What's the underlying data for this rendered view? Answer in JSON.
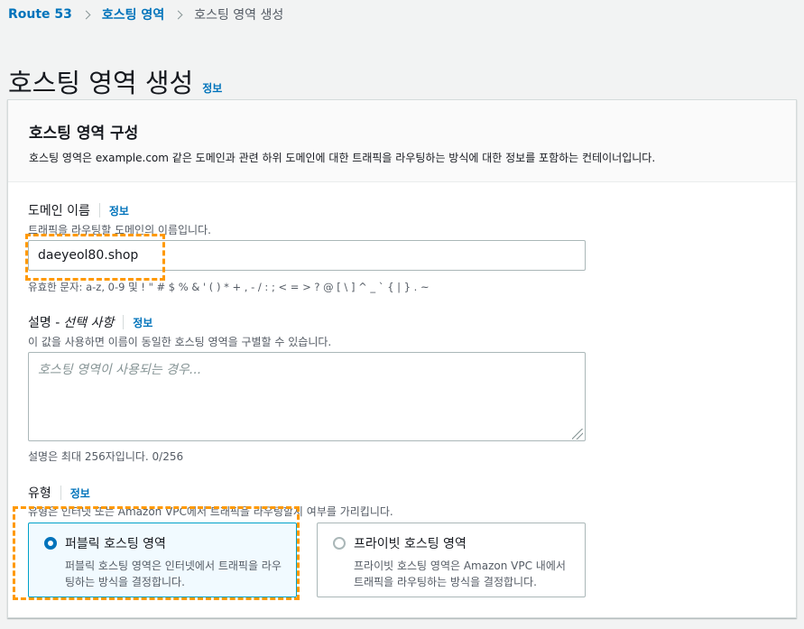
{
  "breadcrumb": {
    "root": "Route 53",
    "parent": "호스팅 영역",
    "current": "호스팅 영역 생성"
  },
  "page": {
    "title": "호스팅 영역 생성",
    "info": "정보"
  },
  "panel": {
    "title": "호스팅 영역 구성",
    "description": "호스팅 영역은 example.com 같은 도메인과 관련 하위 도메인에 대한 트래픽을 라우팅하는 방식에 대한 정보를 포함하는 컨테이너입니다."
  },
  "domain": {
    "label": "도메인 이름",
    "info": "정보",
    "description": "트래픽을 라우팅할 도메인의 이름입니다.",
    "value": "daeyeol80.shop",
    "constraint": "유효한 문자: a-z, 0-9 및 ! \" # $ % & ' ( ) * + , - / : ; < = > ? @ [ \\ ] ^ _ ` { | } . ~"
  },
  "description_field": {
    "label_main": "설명 - ",
    "label_optional": "선택 사항",
    "info": "정보",
    "description": "이 값을 사용하면 이름이 동일한 호스팅 영역을 구별할 수 있습니다.",
    "placeholder": "호스팅 영역이 사용되는 경우...",
    "counter": "설명은 최대 256자입니다. 0/256"
  },
  "type": {
    "label": "유형",
    "info": "정보",
    "description": "유형은 인터넷 또는 Amazon VPC에서 트래픽을 라우팅할지 여부를 가리킵니다.",
    "options": [
      {
        "title": "퍼블릭 호스팅 영역",
        "description": "퍼블릭 호스팅 영역은 인터넷에서 트래픽을 라우팅하는 방식을 결정합니다.",
        "selected": true
      },
      {
        "title": "프라이빗 호스팅 영역",
        "description": "프라이빗 호스팅 영역은 Amazon VPC 내에서 트래픽을 라우팅하는 방식을 결정합니다.",
        "selected": false
      }
    ]
  },
  "colors": {
    "link": "#0073bb",
    "annotation": "#ff9900",
    "selected_border": "#00a1c9"
  }
}
